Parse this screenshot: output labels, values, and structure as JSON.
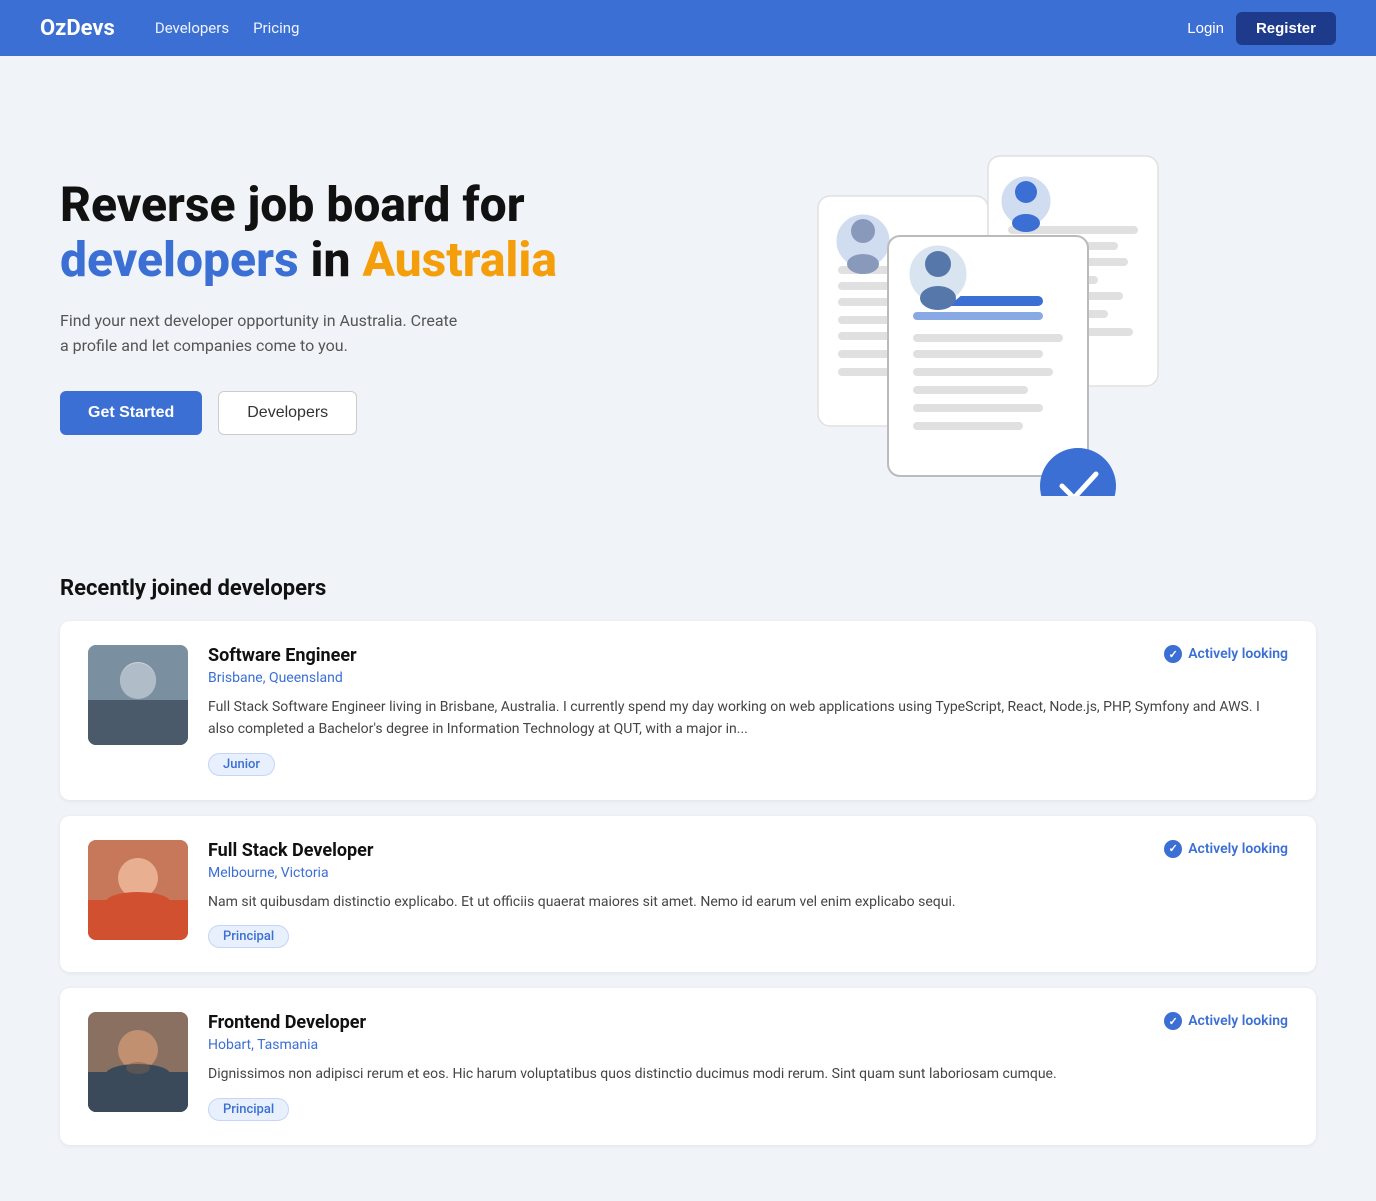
{
  "nav": {
    "logo": "OzDevs",
    "links": [
      {
        "label": "Developers",
        "href": "#"
      },
      {
        "label": "Pricing",
        "href": "#"
      }
    ],
    "login_label": "Login",
    "register_label": "Register"
  },
  "hero": {
    "title_line1": "Reverse job board for",
    "title_word_blue": "developers",
    "title_word_in": " in ",
    "title_word_orange": "Australia",
    "subtitle": "Find your next developer opportunity in Australia. Create a profile and let companies come to you.",
    "cta_primary": "Get Started",
    "cta_secondary": "Developers"
  },
  "recently_joined": {
    "section_title": "Recently joined developers",
    "developers": [
      {
        "name": "Software Engineer",
        "location": "Brisbane, Queensland",
        "bio": "Full Stack Software Engineer living in Brisbane, Australia. I currently spend my day working on web applications using TypeScript, React, Node.js, PHP, Symfony and AWS. I also completed a Bachelor's degree in Information Technology at QUT, with a major in...",
        "badge": "Junior",
        "status": "Actively looking"
      },
      {
        "name": "Full Stack Developer",
        "location": "Melbourne, Victoria",
        "bio": "Nam sit quibusdam distinctio explicabo. Et ut officiis quaerat maiores sit amet. Nemo id earum vel enim explicabo sequi.",
        "badge": "Principal",
        "status": "Actively looking"
      },
      {
        "name": "Frontend Developer",
        "location": "Hobart, Tasmania",
        "bio": "Dignissimos non adipisci rerum et eos. Hic harum voluptatibus quos distinctio ducimus modi rerum. Sint quam sunt laboriosam cumque.",
        "badge": "Principal",
        "status": "Actively looking"
      }
    ]
  },
  "colors": {
    "brand_blue": "#3b6fd4",
    "brand_orange": "#f59e0b"
  }
}
